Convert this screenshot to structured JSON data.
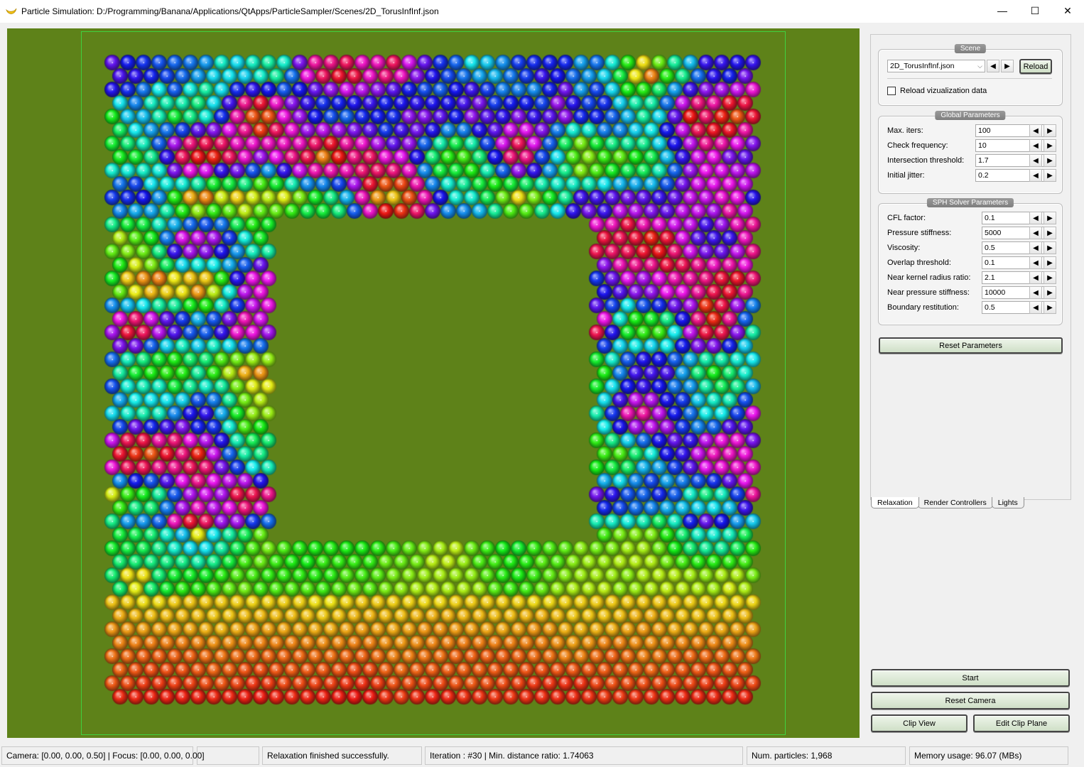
{
  "window": {
    "title": "Particle Simulation: D:/Programming/Banana/Applications/QtApps/ParticleSampler/Scenes/2D_TorusInfInf.json",
    "minimize": "—",
    "maximize": "☐",
    "close": "✕"
  },
  "scene_group": {
    "title": "Scene",
    "scene_file": "2D_TorusInfInf.json",
    "reload_label": "Reload",
    "reload_vis_label": "Reload vizualization data",
    "reload_vis_checked": false
  },
  "global_params": {
    "title": "Global Parameters",
    "items": [
      {
        "label": "Max. iters:",
        "value": "100"
      },
      {
        "label": "Check frequency:",
        "value": "10"
      },
      {
        "label": "Intersection threshold:",
        "value": "1.7"
      },
      {
        "label": "Initial jitter:",
        "value": "0.2"
      }
    ]
  },
  "sph_params": {
    "title": "SPH Solver Parameters",
    "items": [
      {
        "label": "CFL factor:",
        "value": "0.1"
      },
      {
        "label": "Pressure stiffness:",
        "value": "5000"
      },
      {
        "label": "Viscosity:",
        "value": "0.5"
      },
      {
        "label": "Overlap threshold:",
        "value": "0.1"
      },
      {
        "label": "Near kernel radius ratio:",
        "value": "2.1"
      },
      {
        "label": "Near pressure stiffness:",
        "value": "10000"
      },
      {
        "label": "Boundary restitution:",
        "value": "0.5"
      }
    ]
  },
  "reset_params_label": "Reset Parameters",
  "tabs": [
    "Relaxation",
    "Render Controllers",
    "Lights"
  ],
  "active_tab": "Relaxation",
  "actions": {
    "start": "Start",
    "reset_camera": "Reset Camera",
    "clip_view": "Clip View",
    "edit_clip_plane": "Edit Clip Plane"
  },
  "status": {
    "camera": "Camera: [0.00, 0.00, 0.50] | Focus: [0.00, 0.00, 0.00]",
    "progress": "",
    "message": "Relaxation finished successfully.",
    "iteration": "Iteration : #30 | Min. distance ratio: 1.74063",
    "num_particles": "Num. particles: 1,968",
    "memory": "Memory usage: 96.07 (MBs)"
  },
  "colors": {
    "background": "#5e8219",
    "scene_box": "#3fd23f",
    "button_green": "#d8e8d0"
  }
}
